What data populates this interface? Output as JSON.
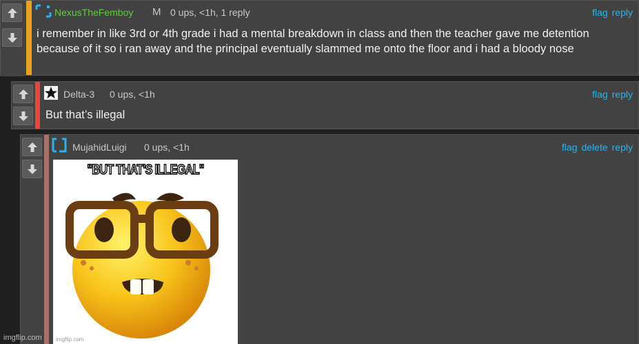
{
  "colors": {
    "background": "#1f1f1f",
    "card": "#424242",
    "action_link": "#22b6f5",
    "stripe_orange": "#e8a21d",
    "stripe_red": "#e8473a",
    "stripe_mauve": "#a7726a"
  },
  "comments": [
    {
      "username": "NexusTheFemboy",
      "username_color": "#5ccd3a",
      "badge": "M",
      "meta": "0 ups, <1h, 1 reply",
      "actions": [
        "flag",
        "reply"
      ],
      "text": "i remember in like 3rd or 4th grade i had a mental breakdown in class and then the teacher gave me detention because of it so i ran away and the principal eventually slammed me onto the floor and i had a bloody nose",
      "avatar_icon": "bracket-logo-icon"
    },
    {
      "username": "Delta-3",
      "username_color": "#c8c8c8",
      "meta": "0 ups, <1h",
      "actions": [
        "flag",
        "reply"
      ],
      "text": "But that’s illegal",
      "avatar_icon": "star-icon"
    },
    {
      "username": "MujahidLuigi",
      "username_color": "#c8c8c8",
      "meta": "0 ups, <1h",
      "actions": [
        "flag",
        "delete",
        "reply"
      ],
      "avatar_icon": "bracket-logo-icon",
      "meme": {
        "caption": "\"BUT THAT'S ILLEGAL\"",
        "watermark": "imgflip.com",
        "image_icon": "nerd-face-emoji-icon"
      }
    }
  ],
  "footer_watermark": "imgflip.com"
}
